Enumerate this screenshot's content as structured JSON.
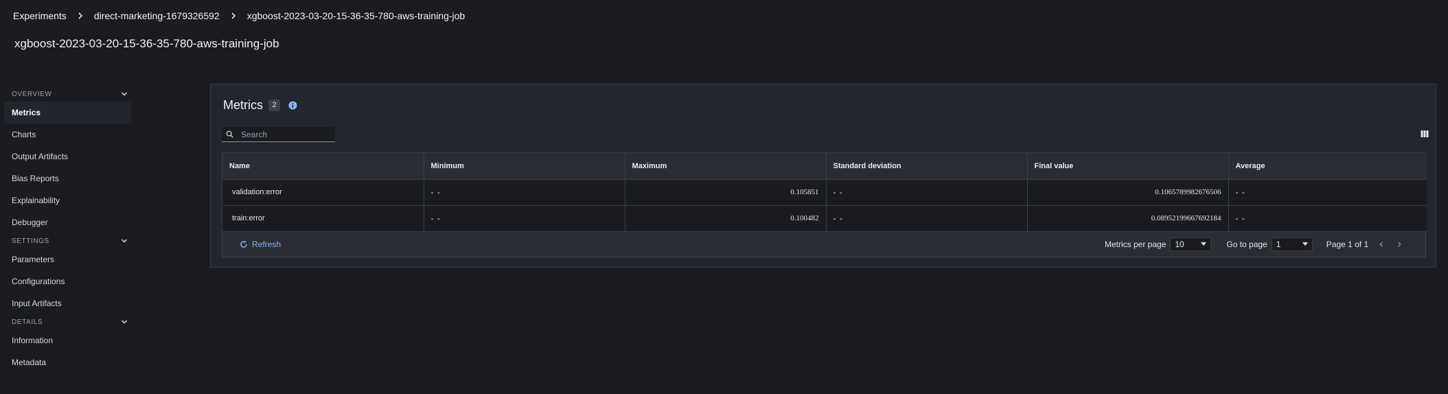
{
  "breadcrumb": {
    "items": [
      "Experiments",
      "direct-marketing-1679326592",
      "xgboost-2023-03-20-15-36-35-780-aws-training-job"
    ]
  },
  "page_title": "xgboost-2023-03-20-15-36-35-780-aws-training-job",
  "sidebar": {
    "sections": [
      {
        "title": "OVERVIEW",
        "items": [
          "Metrics",
          "Charts",
          "Output Artifacts",
          "Bias Reports",
          "Explainability",
          "Debugger"
        ]
      },
      {
        "title": "SETTINGS",
        "items": [
          "Parameters",
          "Configurations",
          "Input Artifacts"
        ]
      },
      {
        "title": "DETAILS",
        "items": [
          "Information",
          "Metadata"
        ]
      }
    ],
    "active_item": "Metrics"
  },
  "panel": {
    "title": "Metrics",
    "count": "2",
    "search_placeholder": "Search"
  },
  "table": {
    "columns": [
      "Name",
      "Minimum",
      "Maximum",
      "Standard deviation",
      "Final value",
      "Average"
    ],
    "rows": [
      {
        "name": "validation:error",
        "minimum": "- -",
        "maximum": "0.105851",
        "std": "- -",
        "final": "0.1065789982676506",
        "average": "- -"
      },
      {
        "name": "train:error",
        "minimum": "- -",
        "maximum": "0.100482",
        "std": "- -",
        "final": "0.08952199667692184",
        "average": "- -"
      }
    ]
  },
  "footer": {
    "refresh_label": "Refresh",
    "per_page_label": "Metrics per page",
    "per_page_value": "10",
    "goto_label": "Go to page",
    "goto_value": "1",
    "page_info": "Page 1 of 1"
  },
  "colors": {
    "background": "#1b1c22",
    "panel": "#24262e",
    "link": "#7fb3f0",
    "info_icon": "#8ab4f8"
  }
}
